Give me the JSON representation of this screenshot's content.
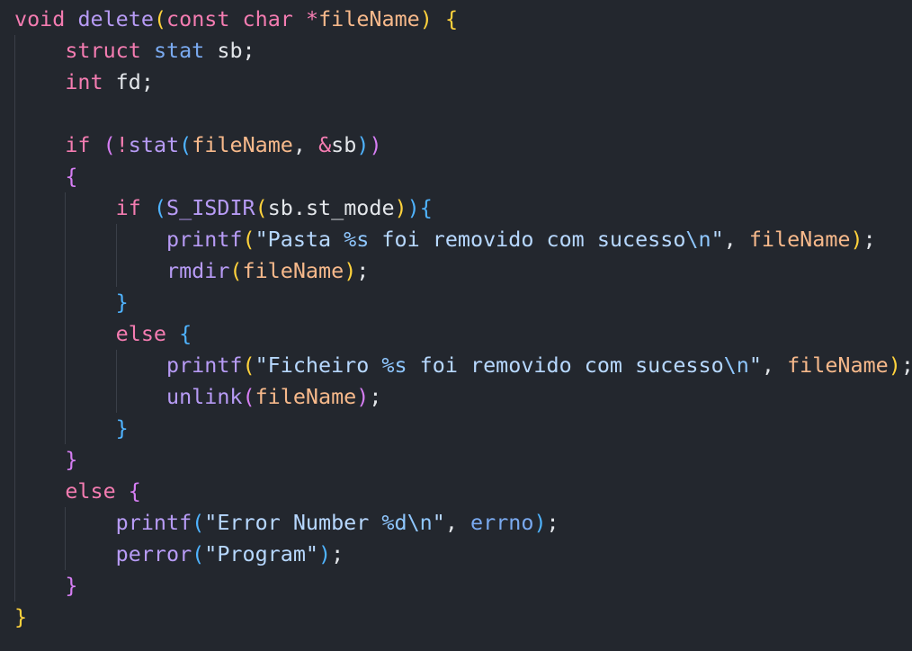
{
  "editor": {
    "background": "#23272e",
    "lines": [
      {
        "indent": 0,
        "tokens": [
          {
            "t": "void",
            "c": "kw"
          },
          {
            "t": " ",
            "c": "txt"
          },
          {
            "t": "delete",
            "c": "fn"
          },
          {
            "t": "(",
            "c": "b1"
          },
          {
            "t": "const",
            "c": "kw"
          },
          {
            "t": " ",
            "c": "txt"
          },
          {
            "t": "char",
            "c": "kw"
          },
          {
            "t": " ",
            "c": "txt"
          },
          {
            "t": "*",
            "c": "op"
          },
          {
            "t": "fileName",
            "c": "prm"
          },
          {
            "t": ")",
            "c": "b1"
          },
          {
            "t": " ",
            "c": "txt"
          },
          {
            "t": "{",
            "c": "b1"
          }
        ]
      },
      {
        "indent": 1,
        "tokens": [
          {
            "t": "struct",
            "c": "kw"
          },
          {
            "t": " ",
            "c": "txt"
          },
          {
            "t": "stat",
            "c": "type"
          },
          {
            "t": " sb;",
            "c": "txt"
          }
        ]
      },
      {
        "indent": 1,
        "tokens": [
          {
            "t": "int",
            "c": "kw"
          },
          {
            "t": " fd;",
            "c": "txt"
          }
        ]
      },
      {
        "indent": 1,
        "tokens": []
      },
      {
        "indent": 1,
        "tokens": [
          {
            "t": "if",
            "c": "kw"
          },
          {
            "t": " ",
            "c": "txt"
          },
          {
            "t": "(",
            "c": "b2"
          },
          {
            "t": "!",
            "c": "op"
          },
          {
            "t": "stat",
            "c": "fn"
          },
          {
            "t": "(",
            "c": "b3"
          },
          {
            "t": "fileName",
            "c": "prm"
          },
          {
            "t": ", ",
            "c": "txt"
          },
          {
            "t": "&",
            "c": "op"
          },
          {
            "t": "sb",
            "c": "txt"
          },
          {
            "t": ")",
            "c": "b3"
          },
          {
            "t": ")",
            "c": "b2"
          }
        ]
      },
      {
        "indent": 1,
        "tokens": [
          {
            "t": "{",
            "c": "b2"
          }
        ]
      },
      {
        "indent": 2,
        "tokens": [
          {
            "t": "if",
            "c": "kw"
          },
          {
            "t": " ",
            "c": "txt"
          },
          {
            "t": "(",
            "c": "b3"
          },
          {
            "t": "S_ISDIR",
            "c": "fn"
          },
          {
            "t": "(",
            "c": "b1"
          },
          {
            "t": "sb.st_mode",
            "c": "txt"
          },
          {
            "t": ")",
            "c": "b1"
          },
          {
            "t": ")",
            "c": "b3"
          },
          {
            "t": "{",
            "c": "b3"
          }
        ]
      },
      {
        "indent": 3,
        "tokens": [
          {
            "t": "printf",
            "c": "fn"
          },
          {
            "t": "(",
            "c": "b1"
          },
          {
            "t": "\"Pasta ",
            "c": "str"
          },
          {
            "t": "%s",
            "c": "esc"
          },
          {
            "t": " foi removido com sucesso",
            "c": "str"
          },
          {
            "t": "\\n",
            "c": "esc"
          },
          {
            "t": "\"",
            "c": "str"
          },
          {
            "t": ", ",
            "c": "txt"
          },
          {
            "t": "fileName",
            "c": "prm"
          },
          {
            "t": ")",
            "c": "b1"
          },
          {
            "t": ";",
            "c": "txt"
          }
        ]
      },
      {
        "indent": 3,
        "tokens": [
          {
            "t": "rmdir",
            "c": "fn"
          },
          {
            "t": "(",
            "c": "b1"
          },
          {
            "t": "fileName",
            "c": "prm"
          },
          {
            "t": ")",
            "c": "b1"
          },
          {
            "t": ";",
            "c": "txt"
          }
        ]
      },
      {
        "indent": 2,
        "tokens": [
          {
            "t": "}",
            "c": "b3"
          }
        ]
      },
      {
        "indent": 2,
        "tokens": [
          {
            "t": "else",
            "c": "kw"
          },
          {
            "t": " ",
            "c": "txt"
          },
          {
            "t": "{",
            "c": "b3"
          }
        ]
      },
      {
        "indent": 3,
        "tokens": [
          {
            "t": "printf",
            "c": "fn"
          },
          {
            "t": "(",
            "c": "b1"
          },
          {
            "t": "\"Ficheiro ",
            "c": "str"
          },
          {
            "t": "%s",
            "c": "esc"
          },
          {
            "t": " foi removido com sucesso",
            "c": "str"
          },
          {
            "t": "\\n",
            "c": "esc"
          },
          {
            "t": "\"",
            "c": "str"
          },
          {
            "t": ", ",
            "c": "txt"
          },
          {
            "t": "fileName",
            "c": "prm"
          },
          {
            "t": ")",
            "c": "b1"
          },
          {
            "t": ";",
            "c": "txt"
          }
        ]
      },
      {
        "indent": 3,
        "tokens": [
          {
            "t": "unlink",
            "c": "fn"
          },
          {
            "t": "(",
            "c": "b2"
          },
          {
            "t": "fileName",
            "c": "prm"
          },
          {
            "t": ")",
            "c": "b2"
          },
          {
            "t": ";",
            "c": "txt"
          }
        ]
      },
      {
        "indent": 2,
        "tokens": [
          {
            "t": "}",
            "c": "b3"
          }
        ]
      },
      {
        "indent": 1,
        "tokens": [
          {
            "t": "}",
            "c": "b2"
          }
        ]
      },
      {
        "indent": 1,
        "tokens": [
          {
            "t": "else",
            "c": "kw"
          },
          {
            "t": " ",
            "c": "txt"
          },
          {
            "t": "{",
            "c": "b2"
          }
        ]
      },
      {
        "indent": 2,
        "tokens": [
          {
            "t": "printf",
            "c": "fn"
          },
          {
            "t": "(",
            "c": "b3"
          },
          {
            "t": "\"Error Number ",
            "c": "str"
          },
          {
            "t": "%d",
            "c": "esc"
          },
          {
            "t": "\\n",
            "c": "esc"
          },
          {
            "t": "\"",
            "c": "str"
          },
          {
            "t": ", ",
            "c": "txt"
          },
          {
            "t": "errno",
            "c": "type"
          },
          {
            "t": ")",
            "c": "b3"
          },
          {
            "t": ";",
            "c": "txt"
          }
        ]
      },
      {
        "indent": 2,
        "tokens": [
          {
            "t": "perror",
            "c": "fn"
          },
          {
            "t": "(",
            "c": "b3"
          },
          {
            "t": "\"Program\"",
            "c": "str"
          },
          {
            "t": ")",
            "c": "b3"
          },
          {
            "t": ";",
            "c": "txt"
          }
        ]
      },
      {
        "indent": 1,
        "tokens": [
          {
            "t": "}",
            "c": "b2"
          }
        ]
      },
      {
        "indent": 0,
        "tokens": [
          {
            "t": "}",
            "c": "b1"
          }
        ]
      }
    ]
  }
}
